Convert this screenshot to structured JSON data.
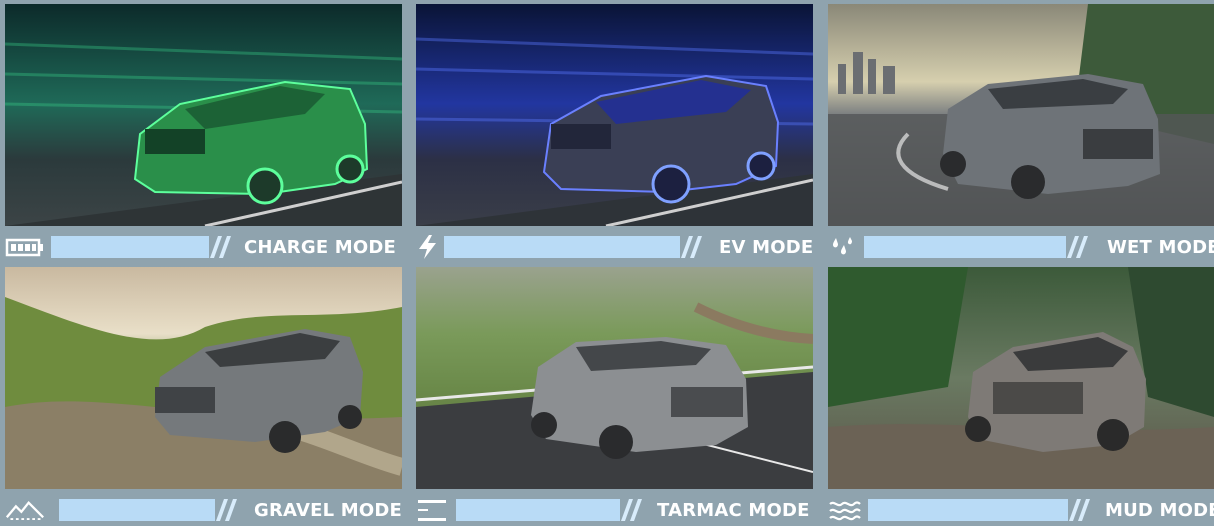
{
  "modes": [
    {
      "label": "CHARGE MODE",
      "icon": "battery-icon"
    },
    {
      "label": "EV MODE",
      "icon": "lightning-bolt-icon"
    },
    {
      "label": "WET MODE",
      "icon": "water-drops-icon"
    },
    {
      "label": "GRAVEL MODE",
      "icon": "mountain-icon"
    },
    {
      "label": "TARMAC MODE",
      "icon": "road-lines-icon"
    },
    {
      "label": "MUD MODE",
      "icon": "waves-icon"
    }
  ],
  "colors": {
    "background": "#8fa3ae",
    "bar_fill": "#b9dbf6",
    "label_text": "#ffffff"
  }
}
